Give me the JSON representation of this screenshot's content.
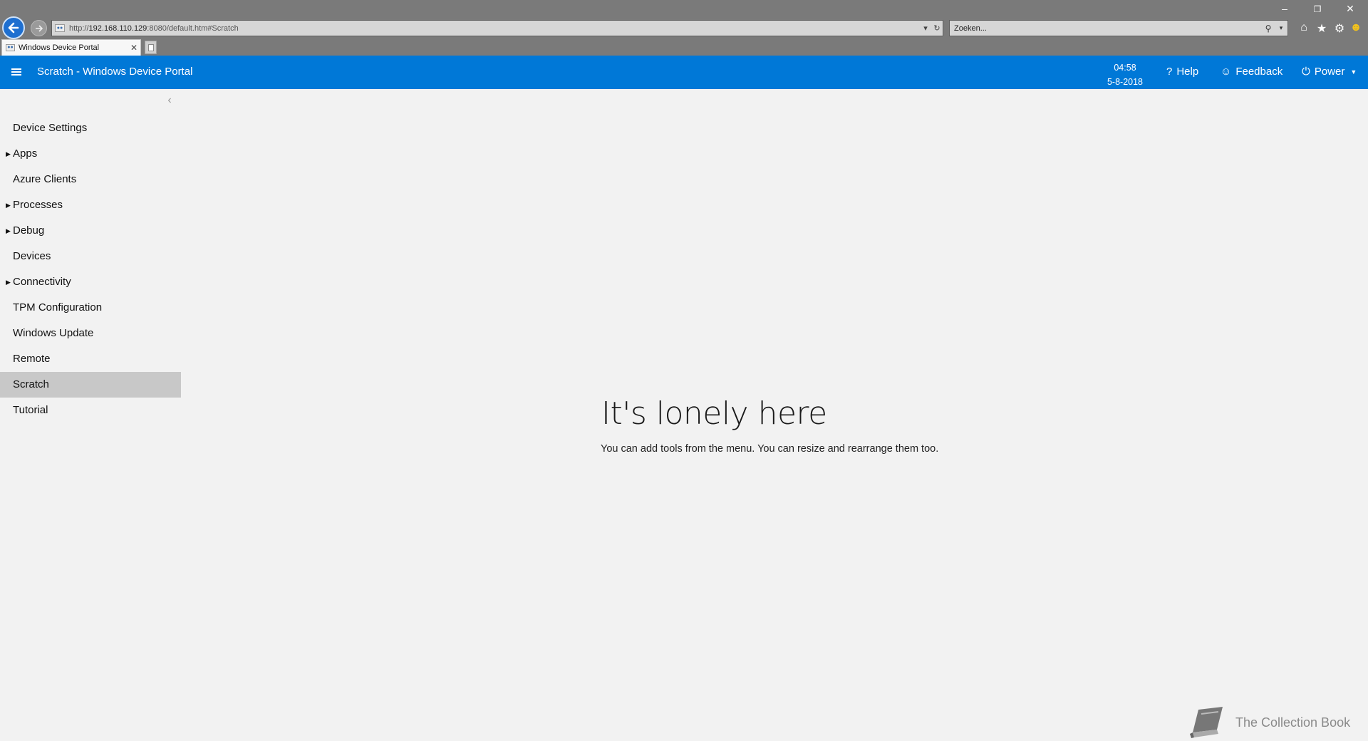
{
  "browser": {
    "url_prefix": "http://",
    "url_host": "192.168.110.129",
    "url_rest": ":8080/default.htm#Scratch",
    "search_placeholder": "Zoeken...",
    "tab_title": "Windows Device Portal",
    "icons": {
      "back": "back-arrow-icon",
      "forward": "forward-arrow-icon",
      "refresh": "refresh-icon",
      "home": "home-icon",
      "favorites": "star-icon",
      "tools": "gear-icon",
      "feedback": "smiley-icon"
    }
  },
  "header": {
    "title": "Scratch - Windows Device Portal",
    "time": "04:58",
    "date": "5-8-2018",
    "help_label": "Help",
    "feedback_label": "Feedback",
    "power_label": "Power",
    "accent_color": "#0078d7"
  },
  "sidebar": {
    "items": [
      {
        "label": "Device Settings",
        "expandable": false
      },
      {
        "label": "Apps",
        "expandable": true
      },
      {
        "label": "Azure Clients",
        "expandable": false
      },
      {
        "label": "Processes",
        "expandable": true
      },
      {
        "label": "Debug",
        "expandable": true
      },
      {
        "label": "Devices",
        "expandable": false
      },
      {
        "label": "Connectivity",
        "expandable": true
      },
      {
        "label": "TPM Configuration",
        "expandable": false
      },
      {
        "label": "Windows Update",
        "expandable": false
      },
      {
        "label": "Remote",
        "expandable": false
      },
      {
        "label": "Scratch",
        "expandable": false,
        "active": true
      },
      {
        "label": "Tutorial",
        "expandable": false
      }
    ]
  },
  "main": {
    "heading": "It's lonely here",
    "subtext": "You can add tools from the menu. You can resize and rearrange them too."
  },
  "watermark": {
    "text": "The Collection Book"
  }
}
